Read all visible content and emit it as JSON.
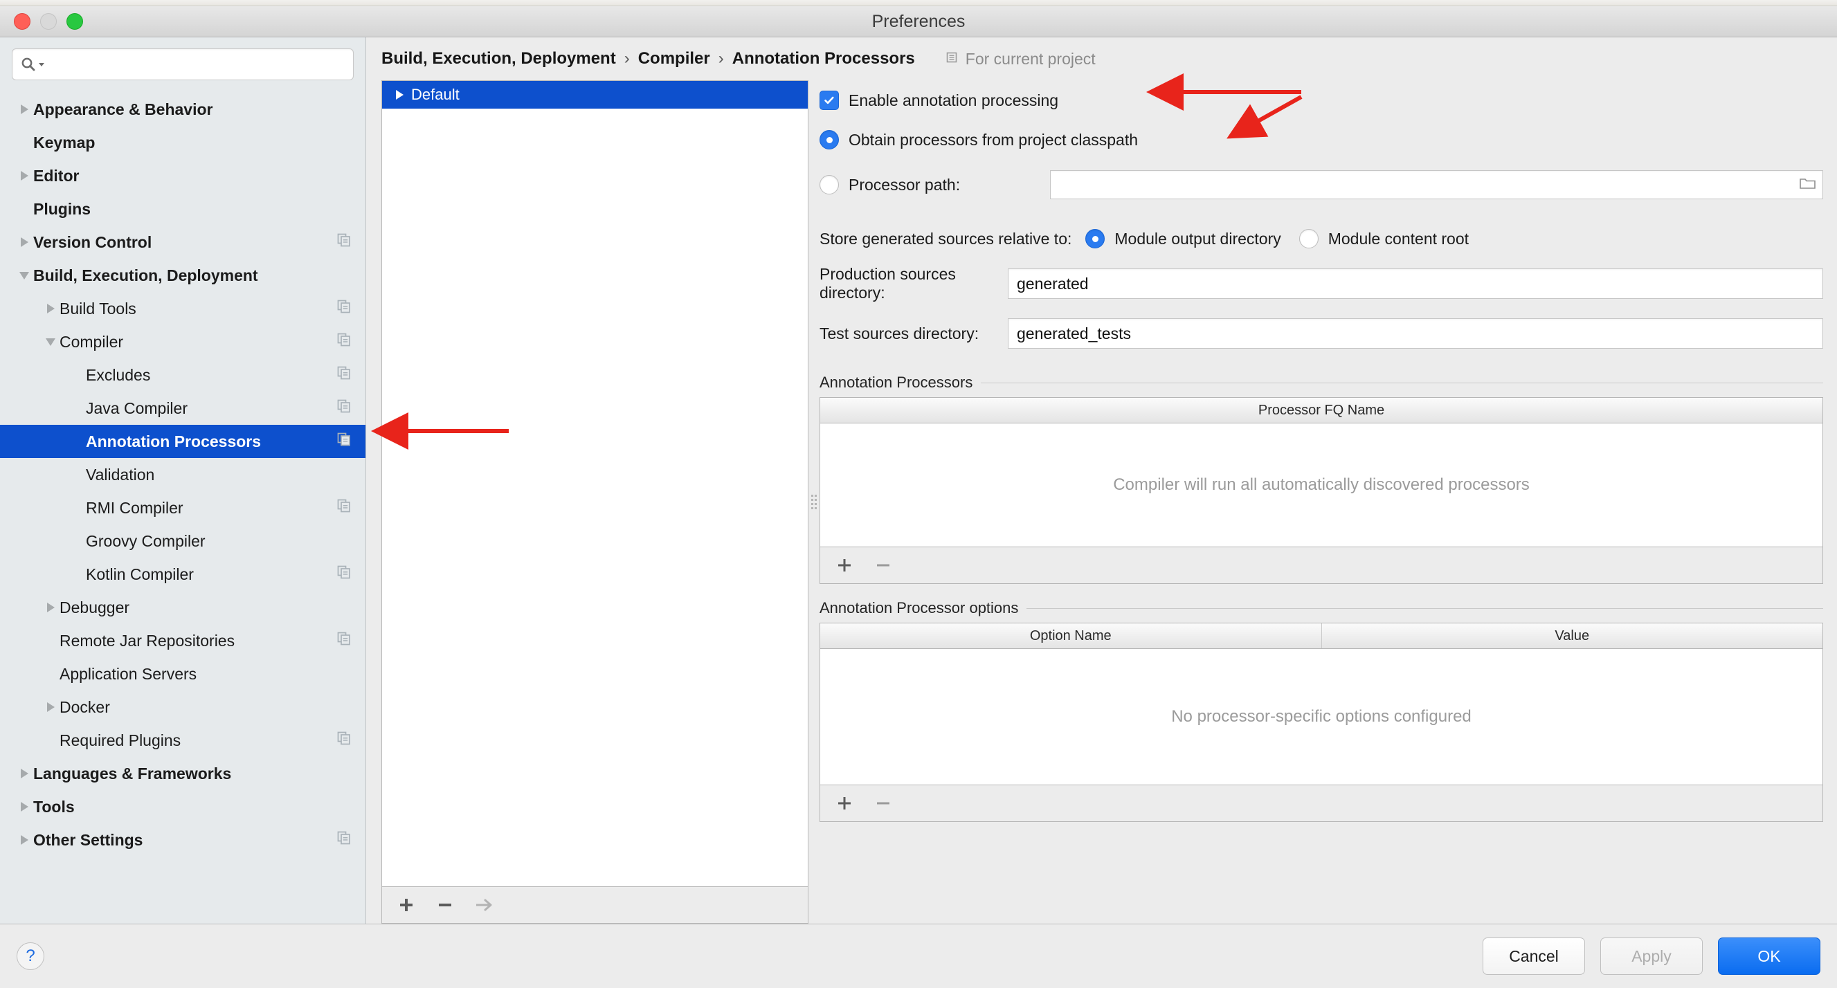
{
  "window": {
    "title": "Preferences",
    "traffic_lights": [
      "close",
      "minimize",
      "zoom"
    ]
  },
  "search": {
    "value": "",
    "placeholder": ""
  },
  "sidebar": {
    "items": [
      {
        "label": "Appearance & Behavior",
        "indent": 0,
        "twisty": "closed",
        "bold": true,
        "badge": false,
        "selected": false
      },
      {
        "label": "Keymap",
        "indent": 0,
        "twisty": "none",
        "bold": true,
        "badge": false,
        "selected": false
      },
      {
        "label": "Editor",
        "indent": 0,
        "twisty": "closed",
        "bold": true,
        "badge": false,
        "selected": false
      },
      {
        "label": "Plugins",
        "indent": 0,
        "twisty": "none",
        "bold": true,
        "badge": false,
        "selected": false
      },
      {
        "label": "Version Control",
        "indent": 0,
        "twisty": "closed",
        "bold": true,
        "badge": true,
        "selected": false
      },
      {
        "label": "Build, Execution, Deployment",
        "indent": 0,
        "twisty": "open",
        "bold": true,
        "badge": false,
        "selected": false
      },
      {
        "label": "Build Tools",
        "indent": 1,
        "twisty": "closed",
        "bold": false,
        "badge": true,
        "selected": false
      },
      {
        "label": "Compiler",
        "indent": 1,
        "twisty": "open",
        "bold": false,
        "badge": true,
        "selected": false
      },
      {
        "label": "Excludes",
        "indent": 2,
        "twisty": "none",
        "bold": false,
        "badge": true,
        "selected": false
      },
      {
        "label": "Java Compiler",
        "indent": 2,
        "twisty": "none",
        "bold": false,
        "badge": true,
        "selected": false
      },
      {
        "label": "Annotation Processors",
        "indent": 2,
        "twisty": "none",
        "bold": true,
        "badge": true,
        "selected": true
      },
      {
        "label": "Validation",
        "indent": 2,
        "twisty": "none",
        "bold": false,
        "badge": false,
        "selected": false
      },
      {
        "label": "RMI Compiler",
        "indent": 2,
        "twisty": "none",
        "bold": false,
        "badge": true,
        "selected": false
      },
      {
        "label": "Groovy Compiler",
        "indent": 2,
        "twisty": "none",
        "bold": false,
        "badge": false,
        "selected": false
      },
      {
        "label": "Kotlin Compiler",
        "indent": 2,
        "twisty": "none",
        "bold": false,
        "badge": true,
        "selected": false
      },
      {
        "label": "Debugger",
        "indent": 1,
        "twisty": "closed",
        "bold": false,
        "badge": false,
        "selected": false
      },
      {
        "label": "Remote Jar Repositories",
        "indent": 1,
        "twisty": "none",
        "bold": false,
        "badge": true,
        "selected": false
      },
      {
        "label": "Application Servers",
        "indent": 1,
        "twisty": "none",
        "bold": false,
        "badge": false,
        "selected": false
      },
      {
        "label": "Docker",
        "indent": 1,
        "twisty": "closed",
        "bold": false,
        "badge": false,
        "selected": false
      },
      {
        "label": "Required Plugins",
        "indent": 1,
        "twisty": "none",
        "bold": false,
        "badge": true,
        "selected": false
      },
      {
        "label": "Languages & Frameworks",
        "indent": 0,
        "twisty": "closed",
        "bold": true,
        "badge": false,
        "selected": false
      },
      {
        "label": "Tools",
        "indent": 0,
        "twisty": "closed",
        "bold": true,
        "badge": false,
        "selected": false
      },
      {
        "label": "Other Settings",
        "indent": 0,
        "twisty": "closed",
        "bold": true,
        "badge": true,
        "selected": false
      }
    ]
  },
  "breadcrumb": {
    "part1": "Build, Execution, Deployment",
    "sep1": "›",
    "part2": "Compiler",
    "sep2": "›",
    "part3": "Annotation Processors",
    "scope_label": "For current project"
  },
  "profiles": {
    "rows": [
      {
        "label": "Default",
        "selected": true,
        "twisty": "closed"
      }
    ],
    "toolbar": {
      "add": "+",
      "remove": "−",
      "move": "→"
    }
  },
  "settings": {
    "enable_annotation_processing": {
      "label": "Enable annotation processing",
      "checked": true
    },
    "obtain_from_classpath": {
      "label": "Obtain processors from project classpath",
      "selected": true
    },
    "processor_path": {
      "label": "Processor path:",
      "selected": false,
      "value": "",
      "browse_icon": "folder-icon"
    },
    "store_relative": {
      "label": "Store generated sources relative to:",
      "options": [
        {
          "label": "Module output directory",
          "selected": true
        },
        {
          "label": "Module content root",
          "selected": false
        }
      ]
    },
    "production_sources": {
      "label": "Production sources directory:",
      "value": "generated"
    },
    "test_sources": {
      "label": "Test sources directory:",
      "value": "generated_tests"
    },
    "processors_group": {
      "title": "Annotation Processors",
      "columns": [
        "Processor FQ Name"
      ],
      "rows": [],
      "empty_text": "Compiler will run all automatically discovered processors",
      "toolbar": {
        "add": "+",
        "remove": "−"
      }
    },
    "options_group": {
      "title": "Annotation Processor options",
      "columns": [
        "Option Name",
        "Value"
      ],
      "rows": [],
      "empty_text": "No processor-specific options configured",
      "toolbar": {
        "add": "+",
        "remove": "−"
      }
    }
  },
  "footer": {
    "help": "?",
    "cancel": "Cancel",
    "apply": "Apply",
    "ok": "OK",
    "apply_disabled": true
  },
  "colors": {
    "selection_blue": "#0d50cd",
    "accent_blue": "#2a7bf0",
    "primary_button": "#0a6cf0",
    "sidebar_bg": "#e6eaec",
    "panel_bg": "#ececec",
    "annotation_arrow": "#e8241b"
  }
}
